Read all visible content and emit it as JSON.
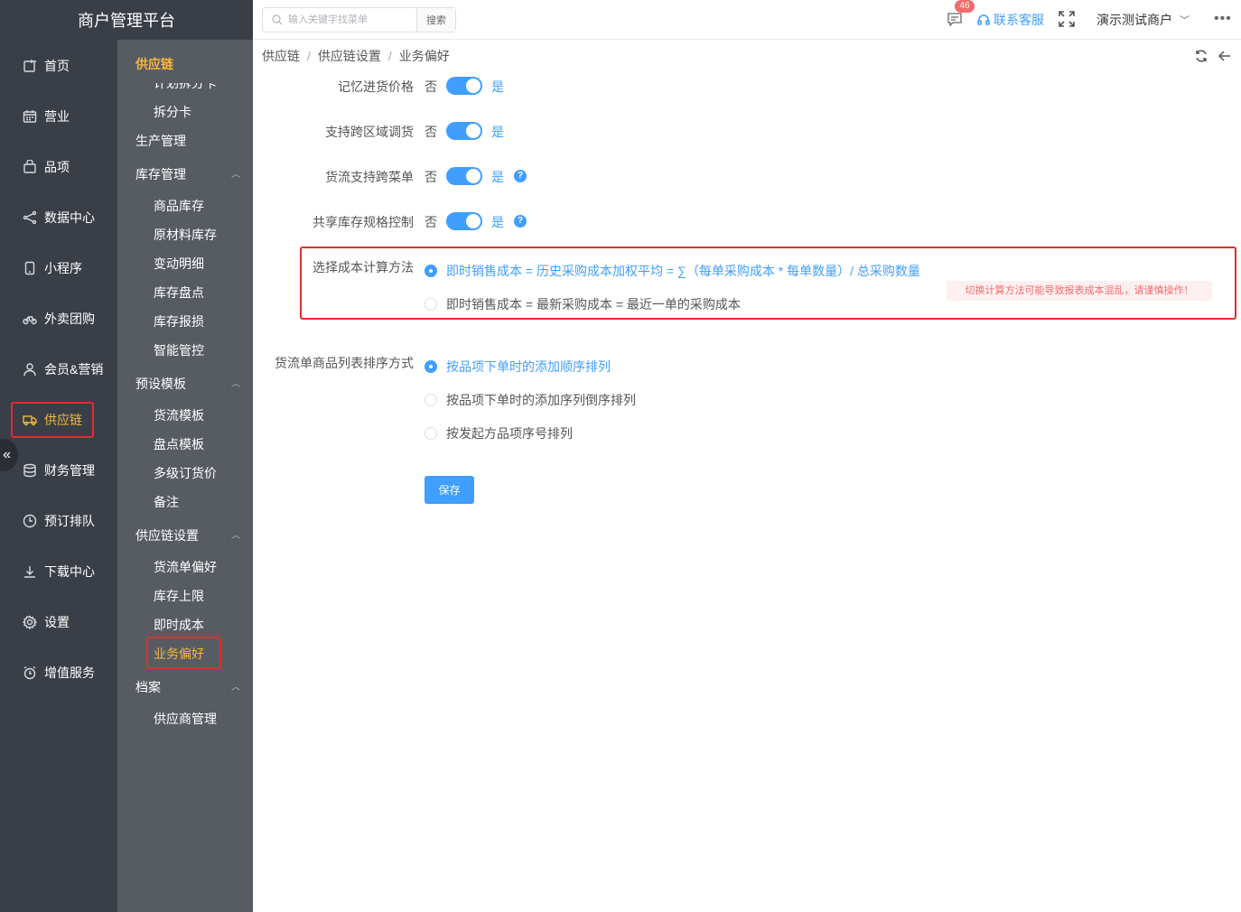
{
  "brand": "商户管理平台",
  "header": {
    "search_placeholder": "输入关键字找菜单",
    "search_button": "搜索",
    "badge_count": "46",
    "service_label": "联系客服",
    "merchant_name": "演示测试商户"
  },
  "main_nav": [
    {
      "label": "首页",
      "icon": "home-icon"
    },
    {
      "label": "营业",
      "icon": "calendar-icon"
    },
    {
      "label": "品项",
      "icon": "bag-icon"
    },
    {
      "label": "数据中心",
      "icon": "share-icon"
    },
    {
      "label": "小程序",
      "icon": "phone-icon"
    },
    {
      "label": "外卖团购",
      "icon": "bike-icon"
    },
    {
      "label": "会员&营销",
      "icon": "user-icon"
    },
    {
      "label": "供应链",
      "icon": "truck-icon",
      "active": true
    },
    {
      "label": "财务管理",
      "icon": "database-icon"
    },
    {
      "label": "预订排队",
      "icon": "clock-icon"
    },
    {
      "label": "下载中心",
      "icon": "download-icon"
    },
    {
      "label": "设置",
      "icon": "gear-icon"
    },
    {
      "label": "增值服务",
      "icon": "alarm-icon"
    }
  ],
  "sub_nav": {
    "title": "供应链",
    "clipped_item": "计划拆分卡",
    "items_top": [
      "拆分卡"
    ],
    "production": "生产管理",
    "inventory_group": "库存管理",
    "inventory_items": [
      "商品库存",
      "原材料库存",
      "变动明细",
      "库存盘点",
      "库存报损",
      "智能管控"
    ],
    "preset_group": "预设模板",
    "preset_items": [
      "货流模板",
      "盘点模板",
      "多级订货价",
      "备注"
    ],
    "settings_group": "供应链设置",
    "settings_items": [
      "货流单偏好",
      "库存上限",
      "即时成本",
      "业务偏好"
    ],
    "archive_group": "档案",
    "archive_items": [
      "供应商管理"
    ]
  },
  "breadcrumb": [
    "供应链",
    "供应链设置",
    "业务偏好"
  ],
  "form": {
    "no_text": "否",
    "yes_text": "是",
    "help_glyph": "?",
    "switches": [
      {
        "label": "记忆进货价格",
        "on": true,
        "help": false
      },
      {
        "label": "支持跨区域调货",
        "on": true,
        "help": false
      },
      {
        "label": "货流支持跨菜单",
        "on": true,
        "help": true
      },
      {
        "label": "共享库存规格控制",
        "on": true,
        "help": true
      }
    ],
    "cost_method": {
      "label": "选择成本计算方法",
      "options": [
        {
          "text": "即时销售成本 = 历史采购成本加权平均 = ∑（每单采购成本 * 每单数量）/ 总采购数量",
          "checked": true
        },
        {
          "text": "即时销售成本 = 最新采购成本 = 最近一单的采购成本",
          "checked": false
        }
      ],
      "warning": "切换计算方法可能导致报表成本混乱，请谨慎操作！"
    },
    "sort_method": {
      "label": "货流单商品列表排序方式",
      "options": [
        {
          "text": "按品项下单时的添加顺序排列",
          "checked": true
        },
        {
          "text": "按品项下单时的添加序列倒序排列",
          "checked": false
        },
        {
          "text": "按发起方品项序号排列",
          "checked": false
        }
      ]
    },
    "save_label": "保存"
  },
  "colors": {
    "accent": "#409eff",
    "highlight": "#e02d2d",
    "nav_active": "#f5b73b",
    "sidebar": "#3a3f47",
    "subbar": "#575c63"
  }
}
